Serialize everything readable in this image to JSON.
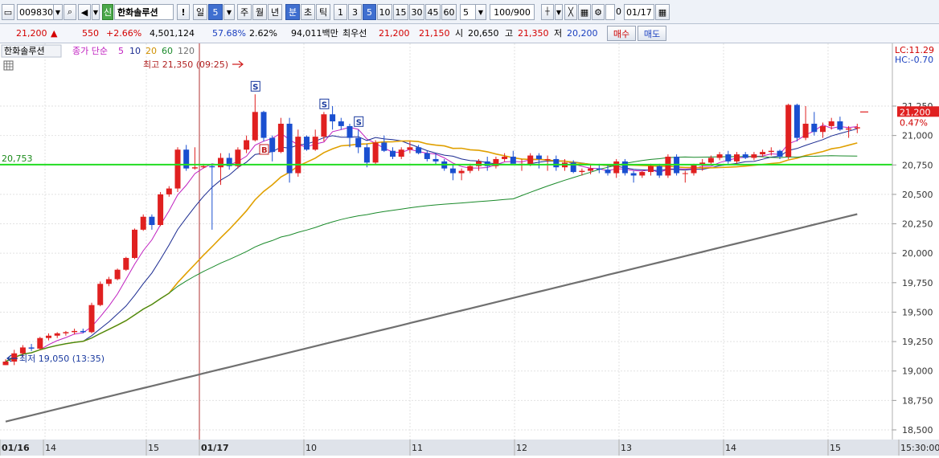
{
  "toolbar": {
    "code": "009830",
    "badge": "신",
    "stock_name": "한화솔루션",
    "alert": "!",
    "period_tabs": [
      "일",
      "5",
      "주",
      "월",
      "년",
      "분",
      "초",
      "틱"
    ],
    "period_selected": "5",
    "minute_tabs": [
      "1",
      "3",
      "5",
      "10",
      "15",
      "30",
      "45",
      "60"
    ],
    "minute_selected": "5",
    "count_value": "5",
    "display_count": "100/900",
    "date_value": "01/17",
    "checkbox_label": "0"
  },
  "quote": {
    "price": "21,200",
    "arrow": "▲",
    "change": "550",
    "change_pct": "+2.66%",
    "volume": "4,501,124",
    "turnover": "57.68%",
    "ratio": "2.62%",
    "amount": "94,011백만",
    "best_label": "최우선",
    "best_ask": "21,200",
    "best_bid": "21,150",
    "open_label": "시",
    "open": "20,650",
    "high_label": "고",
    "high": "21,350",
    "low_label": "저",
    "low": "20,200",
    "buy_label": "매수",
    "sell_label": "매도"
  },
  "legend": {
    "name": "한화솔루션",
    "ma_label": "종가 단순",
    "ma5": "5",
    "ma10": "10",
    "ma20": "20",
    "ma60": "60",
    "ma120": "120"
  },
  "annotations": {
    "high_text": "최고 21,350 (09:25)",
    "low_text": "최저 19,050 (13:35)",
    "hline_label": "20,753",
    "lc": "LC:11.29",
    "hc": "HC:-0.70",
    "price_tag": "21,200",
    "pct_tag": "0.47%"
  },
  "colors": {
    "up": "#e02020",
    "down": "#1a4fd0",
    "ma5": "#c020c0",
    "ma10": "#1a2a90",
    "ma20": "#e0a000",
    "ma60": "#1a8a2a",
    "ma120": "#707070",
    "hline": "#22dd22"
  },
  "chart_data": {
    "type": "candlestick",
    "ylim": [
      18500,
      21350
    ],
    "y_ticks": [
      "21,250",
      "21,000",
      "20,750",
      "20,500",
      "20,250",
      "20,000",
      "19,750",
      "19,500",
      "19,250",
      "19,000",
      "18,750",
      "18,500"
    ],
    "x_labels": [
      "01/16",
      "14",
      "15",
      "01/17",
      "10",
      "11",
      "12",
      "13",
      "14",
      "15",
      "15:30:00"
    ],
    "time_label": "15:30:00",
    "hline": 20753,
    "signals": [
      "S",
      "B",
      "S",
      "S"
    ],
    "candles": [
      [
        19050,
        19100,
        19050,
        19080
      ],
      [
        19080,
        19180,
        19050,
        19150
      ],
      [
        19150,
        19220,
        19120,
        19200
      ],
      [
        19200,
        19230,
        19170,
        19190
      ],
      [
        19190,
        19290,
        19180,
        19280
      ],
      [
        19280,
        19320,
        19260,
        19300
      ],
      [
        19300,
        19330,
        19280,
        19320
      ],
      [
        19320,
        19340,
        19300,
        19330
      ],
      [
        19330,
        19360,
        19310,
        19340
      ],
      [
        19340,
        19360,
        19320,
        19330
      ],
      [
        19330,
        19580,
        19320,
        19560
      ],
      [
        19560,
        19760,
        19550,
        19740
      ],
      [
        19740,
        19800,
        19720,
        19780
      ],
      [
        19780,
        19870,
        19770,
        19860
      ],
      [
        19860,
        19970,
        19850,
        19960
      ],
      [
        19960,
        20210,
        19950,
        20200
      ],
      [
        20200,
        20330,
        20190,
        20310
      ],
      [
        20310,
        20330,
        20200,
        20240
      ],
      [
        20240,
        20520,
        20230,
        20500
      ],
      [
        20500,
        20570,
        20480,
        20550
      ],
      [
        20550,
        20900,
        20520,
        20880
      ],
      [
        20880,
        20920,
        20700,
        20720
      ],
      [
        20720,
        20900,
        20710,
        20730
      ],
      [
        20730,
        20760,
        20720,
        20740
      ],
      [
        20740,
        20760,
        20200,
        20730
      ],
      [
        20730,
        20850,
        20580,
        20810
      ],
      [
        20810,
        20850,
        20710,
        20740
      ],
      [
        20740,
        20900,
        20720,
        20880
      ],
      [
        20880,
        21000,
        20850,
        20960
      ],
      [
        20960,
        21350,
        20950,
        21200
      ],
      [
        21200,
        21210,
        20950,
        20980
      ],
      [
        20980,
        21000,
        20780,
        20860
      ],
      [
        20860,
        21150,
        20850,
        21100
      ],
      [
        21100,
        21150,
        20600,
        20680
      ],
      [
        20680,
        21050,
        20650,
        20990
      ],
      [
        20990,
        21000,
        20870,
        20880
      ],
      [
        20880,
        21050,
        20870,
        20990
      ],
      [
        20990,
        21200,
        20950,
        21180
      ],
      [
        21180,
        21250,
        21050,
        21120
      ],
      [
        21120,
        21150,
        21050,
        21080
      ],
      [
        21080,
        21100,
        20900,
        20980
      ],
      [
        20980,
        21050,
        20850,
        20900
      ],
      [
        20900,
        20930,
        20730,
        20770
      ],
      [
        20770,
        20960,
        20750,
        20940
      ],
      [
        20940,
        21000,
        20860,
        20870
      ],
      [
        20870,
        20900,
        20800,
        20820
      ],
      [
        20820,
        20900,
        20800,
        20880
      ],
      [
        20880,
        20950,
        20850,
        20900
      ],
      [
        20900,
        20920,
        20840,
        20850
      ],
      [
        20850,
        20870,
        20780,
        20800
      ],
      [
        20800,
        20850,
        20750,
        20780
      ],
      [
        20780,
        20800,
        20700,
        20720
      ],
      [
        20720,
        20750,
        20620,
        20680
      ],
      [
        20680,
        20720,
        20620,
        20700
      ],
      [
        20700,
        20760,
        20680,
        20740
      ],
      [
        20740,
        20800,
        20700,
        20780
      ],
      [
        20780,
        20820,
        20700,
        20740
      ],
      [
        20740,
        20820,
        20720,
        20800
      ],
      [
        20800,
        20850,
        20780,
        20820
      ],
      [
        20820,
        20870,
        20790,
        20760
      ],
      [
        20760,
        20800,
        20700,
        20760
      ],
      [
        20760,
        20850,
        20740,
        20830
      ],
      [
        20830,
        20850,
        20720,
        20800
      ],
      [
        20800,
        20830,
        20700,
        20800
      ],
      [
        20800,
        20830,
        20700,
        20730
      ],
      [
        20730,
        20800,
        20700,
        20770
      ],
      [
        20770,
        20790,
        20680,
        20690
      ],
      [
        20690,
        20720,
        20660,
        20700
      ],
      [
        20700,
        20750,
        20670,
        20720
      ],
      [
        20720,
        20760,
        20680,
        20710
      ],
      [
        20710,
        20750,
        20660,
        20680
      ],
      [
        20680,
        20800,
        20640,
        20780
      ],
      [
        20780,
        20800,
        20660,
        20680
      ],
      [
        20680,
        20700,
        20600,
        20660
      ],
      [
        20660,
        20700,
        20640,
        20690
      ],
      [
        20690,
        20760,
        20660,
        20740
      ],
      [
        20740,
        20760,
        20640,
        20660
      ],
      [
        20660,
        20840,
        20640,
        20820
      ],
      [
        20820,
        20840,
        20660,
        20680
      ],
      [
        20680,
        20700,
        20600,
        20680
      ],
      [
        20680,
        20760,
        20660,
        20750
      ],
      [
        20750,
        20800,
        20700,
        20770
      ],
      [
        20770,
        20830,
        20750,
        20810
      ],
      [
        20810,
        20860,
        20790,
        20840
      ],
      [
        20840,
        20870,
        20760,
        20780
      ],
      [
        20780,
        20860,
        20760,
        20840
      ],
      [
        20840,
        20860,
        20800,
        20810
      ],
      [
        20810,
        20860,
        20790,
        20840
      ],
      [
        20840,
        20880,
        20820,
        20860
      ],
      [
        20860,
        20900,
        20830,
        20870
      ],
      [
        20870,
        20880,
        20800,
        20820
      ],
      [
        20820,
        21270,
        20800,
        21260
      ],
      [
        21260,
        21270,
        20950,
        20980
      ],
      [
        20980,
        21250,
        20960,
        21100
      ],
      [
        21100,
        21200,
        21000,
        21030
      ],
      [
        21030,
        21110,
        20980,
        21080
      ],
      [
        21080,
        21150,
        21050,
        21120
      ],
      [
        21120,
        21160,
        21040,
        21050
      ],
      [
        21050,
        21080,
        20980,
        21060
      ],
      [
        21060,
        21100,
        21020,
        21070
      ]
    ]
  }
}
